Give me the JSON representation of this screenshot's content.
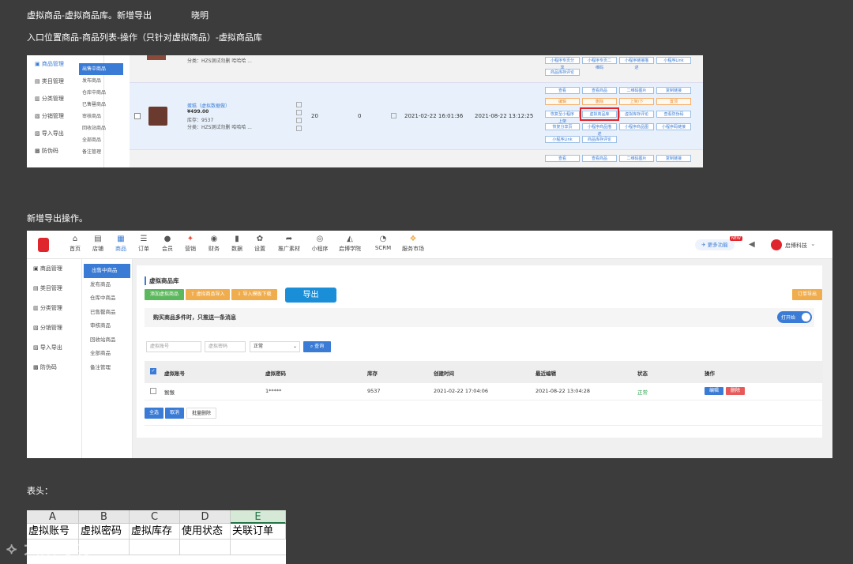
{
  "doc": {
    "title": "虚拟商品-虚拟商品库。新增导出",
    "author": "晓明",
    "entry": "入口位置商品-商品列表-操作（只针对虚拟商品）-虚拟商品库",
    "section2": "新增导出操作。",
    "section3": "表头："
  },
  "fig1": {
    "nav1": [
      "商品管理",
      "类目管理",
      "分类管理",
      "分销管理",
      "导入导出",
      "防伪码"
    ],
    "nav2": [
      "出售中商品",
      "发布商品",
      "仓库中商品",
      "已售罄商品",
      "审核商品",
      "回收站商品",
      "全部商品",
      "备注管理"
    ],
    "row1_spec": "分类：HZS测试勿删 哈哈哈 ...",
    "product_name": "蛋糕（虚拟数据做）",
    "price": "¥499.00",
    "stock": "库存：9537",
    "category": "分类：HZS测试勿删 哈哈哈 ...",
    "qty": "20",
    "sold": "0",
    "created": "2021-02-22 16:01:36",
    "updated": "2021-08-22 13:12:25",
    "top_buttons": [
      "小程序专页分享",
      "小程序专页二维码",
      "小程序链接描述",
      "小程序Link"
    ],
    "top_buttons2": [
      "商品库存评论"
    ],
    "ops_row1": [
      "查看",
      "查看商品",
      "二维码图片",
      "复制链接"
    ],
    "ops_row2": [
      "编辑",
      "删除",
      "上架/下",
      "置顶"
    ],
    "ops_row3": [
      "恢复至小程序上架",
      "虚拟商品库",
      "虚拟库存评论",
      "查看防伪码"
    ],
    "ops_row4": [
      "恢复分享页",
      "小程序商品描述",
      "小程序商品图",
      "小程序码链接"
    ],
    "ops_row5": [
      "小程序Link",
      "商品库存评论"
    ],
    "ops_bottom": [
      "查看",
      "查看商品",
      "二维码图片",
      "复制链接"
    ]
  },
  "fig2": {
    "topnav": [
      {
        "icon": "⌂",
        "label": "首页"
      },
      {
        "icon": "▤",
        "label": "店铺"
      },
      {
        "icon": "▦",
        "label": "商品"
      },
      {
        "icon": "☰",
        "label": "订单"
      },
      {
        "icon": "●",
        "label": "会员"
      },
      {
        "icon": "✦",
        "label": "营销"
      },
      {
        "icon": "◉",
        "label": "财务"
      },
      {
        "icon": "▮",
        "label": "数据"
      },
      {
        "icon": "✿",
        "label": "设置"
      },
      {
        "icon": "➦",
        "label": "推广素材"
      },
      {
        "icon": "◎",
        "label": "小程序"
      },
      {
        "icon": "◭",
        "label": "启博学院"
      },
      {
        "icon": "◔",
        "label": "SCRM"
      },
      {
        "icon": "❖",
        "label": "服务市场"
      }
    ],
    "more_features": "更多功能",
    "new_badge": "NEW",
    "brand": "启博科技",
    "side1": [
      "商品管理",
      "类目管理",
      "分类管理",
      "分销管理",
      "导入导出",
      "防伪码"
    ],
    "side2": [
      "出售中商品",
      "发布商品",
      "仓库中商品",
      "已售罄商品",
      "审核商品",
      "回收站商品",
      "全部商品",
      "备注管理"
    ],
    "panel_title": "虚拟商品库",
    "btn_add": "添加虚拟商品",
    "btn_import": "虚拟商品导入",
    "btn_template": "导入模板下载",
    "btn_export": "导出",
    "btn_order_export": "订单导出",
    "notice": "购买商品多件时，只推送一条消息",
    "toggle": "打开始",
    "search_account_ph": "虚拟账号",
    "search_password_ph": "虚拟密码",
    "status_select": "正常",
    "btn_query": "查询",
    "table_headers": [
      "虚拟账号",
      "虚拟密码",
      "库存",
      "创建时间",
      "最近编辑",
      "状态",
      "操作"
    ],
    "row": {
      "account": "猴猴",
      "password": "1*****",
      "stock": "9537",
      "created": "2021-02-22 17:04:06",
      "edited": "2021-08-22 13:04:28",
      "status": "正常",
      "edit": "编辑",
      "delete": "删除"
    },
    "btn_select_all": "全选",
    "btn_cancel": "取消",
    "btn_batch_delete": "批量删除"
  },
  "fig3": {
    "columns": [
      "A",
      "B",
      "C",
      "D",
      "E"
    ],
    "headers": [
      "虚拟账号",
      "虚拟密码",
      "虚拟库存",
      "使用状态",
      "关联订单"
    ]
  },
  "watermark": "大数跨境",
  "colors": {
    "background": "#3c3c3c",
    "accent": "#3a7bd5",
    "export": "#1a8fd8",
    "green": "#5cb85c",
    "orange": "#f0ad4e",
    "red": "#e0262d"
  }
}
